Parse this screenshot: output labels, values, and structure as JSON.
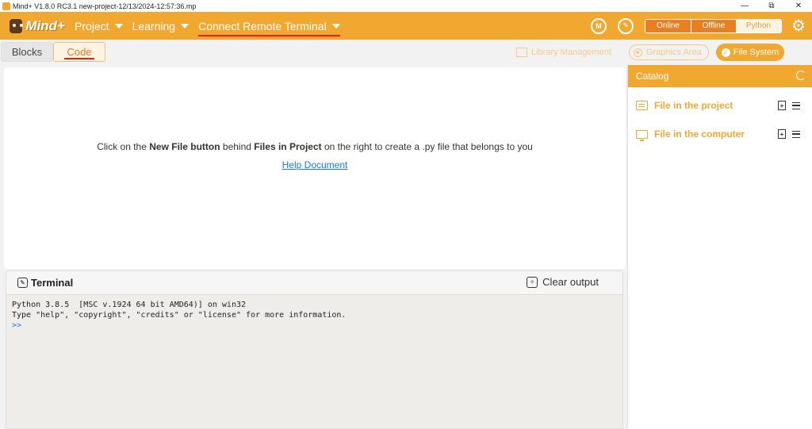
{
  "window": {
    "title": "Mind+ V1.8.0 RC3.1   new-project-12/13/2024-12:57:36.mp",
    "minimize": "—",
    "restore": "⧉",
    "close": "✕"
  },
  "menubar": {
    "logo": "Mind+",
    "items": [
      {
        "label": "Project"
      },
      {
        "label": "Learning"
      },
      {
        "label": "Connect Remote Terminal"
      }
    ],
    "icons": [
      "M",
      "✎"
    ],
    "modes": [
      {
        "label": "Online"
      },
      {
        "label": "Offline"
      },
      {
        "label": "Python",
        "active": true
      }
    ]
  },
  "tabs": {
    "blocks": "Blocks",
    "code": "Code"
  },
  "side_tools": {
    "library": "Library Management",
    "graphics": "Graphics Area",
    "filesystem": "File System"
  },
  "editor": {
    "hint_pre": "Click on the ",
    "hint_bold1": "New File button",
    "hint_mid": " behind ",
    "hint_bold2": "Files in Project",
    "hint_post": " on the right to create a .py file that belongs to you",
    "help_link": "Help Document"
  },
  "terminal": {
    "title": "Terminal",
    "clear": "Clear output",
    "line1": "Python 3.8.5  [MSC v.1924 64 bit AMD64)] on win32",
    "line2": "Type \"help\", \"copyright\", \"credits\" or \"license\" for more information.",
    "prompt": ">>"
  },
  "catalog": {
    "title": "Catalog",
    "items": [
      {
        "label": "File in the project"
      },
      {
        "label": "File in the computer"
      }
    ]
  },
  "colors": {
    "accent": "#f0a830",
    "accent_dark": "#ea7f22",
    "underline": "#e02020",
    "link": "#1a7bd4"
  }
}
